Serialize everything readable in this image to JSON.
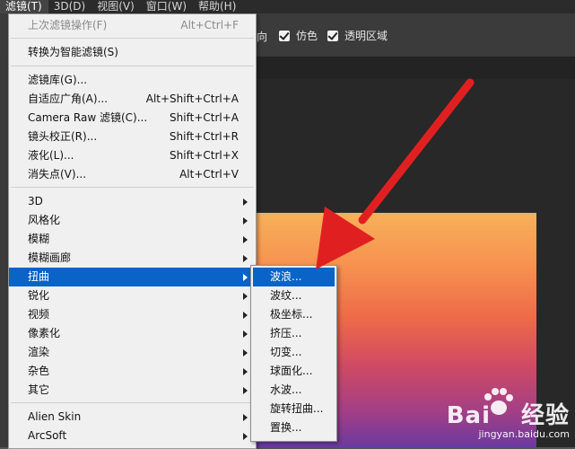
{
  "menubar": {
    "items": [
      {
        "label": "滤镜(T)",
        "active": true
      },
      {
        "label": "3D(D)",
        "active": false
      },
      {
        "label": "视图(V)",
        "active": false
      },
      {
        "label": "窗口(W)",
        "active": false
      },
      {
        "label": "帮助(H)",
        "active": false
      }
    ]
  },
  "options_bar": {
    "partial_label": "向",
    "checkboxes": [
      {
        "label": "仿色",
        "checked": true
      },
      {
        "label": "透明区域",
        "checked": true
      }
    ]
  },
  "filter_menu": {
    "items": [
      {
        "label": "上次滤镜操作(F)",
        "shortcut": "Alt+Ctrl+F",
        "disabled": true
      },
      {
        "label": "转换为智能滤镜(S)",
        "shortcut": ""
      },
      {
        "label": "滤镜库(G)...",
        "shortcut": ""
      },
      {
        "label": "自适应广角(A)...",
        "shortcut": "Alt+Shift+Ctrl+A"
      },
      {
        "label": "Camera Raw 滤镜(C)...",
        "shortcut": "Shift+Ctrl+A"
      },
      {
        "label": "镜头校正(R)...",
        "shortcut": "Shift+Ctrl+R"
      },
      {
        "label": "液化(L)...",
        "shortcut": "Shift+Ctrl+X"
      },
      {
        "label": "消失点(V)...",
        "shortcut": "Alt+Ctrl+V"
      },
      {
        "label": "3D",
        "submenu": true
      },
      {
        "label": "风格化",
        "submenu": true
      },
      {
        "label": "模糊",
        "submenu": true
      },
      {
        "label": "模糊画廊",
        "submenu": true
      },
      {
        "label": "扭曲",
        "submenu": true,
        "selected": true
      },
      {
        "label": "锐化",
        "submenu": true
      },
      {
        "label": "视频",
        "submenu": true
      },
      {
        "label": "像素化",
        "submenu": true
      },
      {
        "label": "渲染",
        "submenu": true
      },
      {
        "label": "杂色",
        "submenu": true
      },
      {
        "label": "其它",
        "submenu": true
      },
      {
        "label": "Alien Skin",
        "submenu": true
      },
      {
        "label": "ArcSoft",
        "submenu": true
      }
    ]
  },
  "distort_submenu": {
    "items": [
      {
        "label": "波浪...",
        "selected": true
      },
      {
        "label": "波纹..."
      },
      {
        "label": "极坐标..."
      },
      {
        "label": "挤压..."
      },
      {
        "label": "切变..."
      },
      {
        "label": "球面化..."
      },
      {
        "label": "水波..."
      },
      {
        "label": "旋转扭曲..."
      },
      {
        "label": "置换..."
      }
    ]
  },
  "watermark": {
    "brand": "Bai",
    "brand2": "经验",
    "url": "jingyan.baidu.com"
  },
  "colors": {
    "selection": "#0a64c8",
    "annotation_arrow": "#e02020"
  }
}
